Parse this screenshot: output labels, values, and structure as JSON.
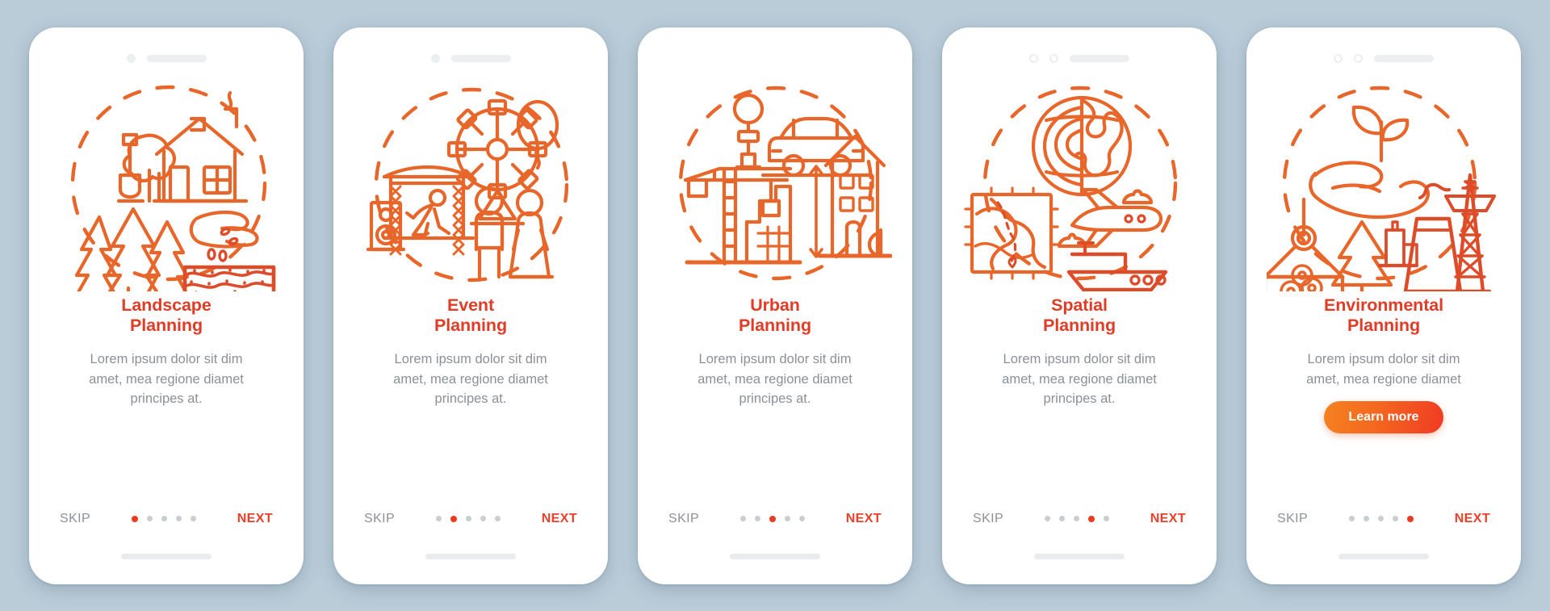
{
  "theme": {
    "background": "#b9ccd8",
    "card_background": "#ffffff",
    "title_color": "#e03c26",
    "body_color": "#8b9196",
    "accent_color": "#ec3a1e",
    "next_color": "#e8402a",
    "skip_color": "#8b9196",
    "dot_inactive_color": "#c9ced2",
    "illustration_stroke": "#e8662a",
    "illustration_stroke_dark": "#dd4b29",
    "cta_gradient_from": "#f58220",
    "cta_gradient_to": "#ef3b24"
  },
  "screens": [
    {
      "id": "landscape-planning",
      "notch": {
        "camera_style": "dot",
        "speaker": true
      },
      "illustration_name": "landscape-planning-illustration",
      "title": "Landscape\nPlanning",
      "body": "Lorem ipsum dolor sit dim\namet, mea regione diamet\nprincipes at.",
      "cta": null,
      "nav": {
        "skip_label": "SKIP",
        "next_label": "NEXT",
        "dot_count": 5,
        "active_dot": 1
      }
    },
    {
      "id": "event-planning",
      "notch": {
        "camera_style": "dot",
        "speaker": true
      },
      "illustration_name": "event-planning-illustration",
      "title": "Event\nPlanning",
      "body": "Lorem ipsum dolor sit dim\namet, mea regione diamet\nprincipes at.",
      "cta": null,
      "nav": {
        "skip_label": "SKIP",
        "next_label": "NEXT",
        "dot_count": 5,
        "active_dot": 2
      }
    },
    {
      "id": "urban-planning",
      "notch": {
        "camera_style": "none",
        "speaker": false
      },
      "illustration_name": "urban-planning-illustration",
      "title": "Urban\nPlanning",
      "body": "Lorem ipsum dolor sit dim\namet, mea regione diamet\nprincipes at.",
      "cta": null,
      "nav": {
        "skip_label": "SKIP",
        "next_label": "NEXT",
        "dot_count": 5,
        "active_dot": 3
      }
    },
    {
      "id": "spatial-planning",
      "notch": {
        "camera_style": "double-ring",
        "speaker": true
      },
      "illustration_name": "spatial-planning-illustration",
      "title": "Spatial\nPlanning",
      "body": "Lorem ipsum dolor sit dim\namet, mea regione diamet\nprincipes at.",
      "cta": null,
      "nav": {
        "skip_label": "SKIP",
        "next_label": "NEXT",
        "dot_count": 5,
        "active_dot": 4
      }
    },
    {
      "id": "environmental-planning",
      "notch": {
        "camera_style": "double-ring",
        "speaker": true
      },
      "illustration_name": "environmental-planning-illustration",
      "title": "Environmental\nPlanning",
      "body": "Lorem ipsum dolor sit dim\namet, mea regione diamet",
      "cta": {
        "label": "Learn more"
      },
      "nav": {
        "skip_label": "SKIP",
        "next_label": "NEXT",
        "dot_count": 5,
        "active_dot": 5
      }
    }
  ]
}
